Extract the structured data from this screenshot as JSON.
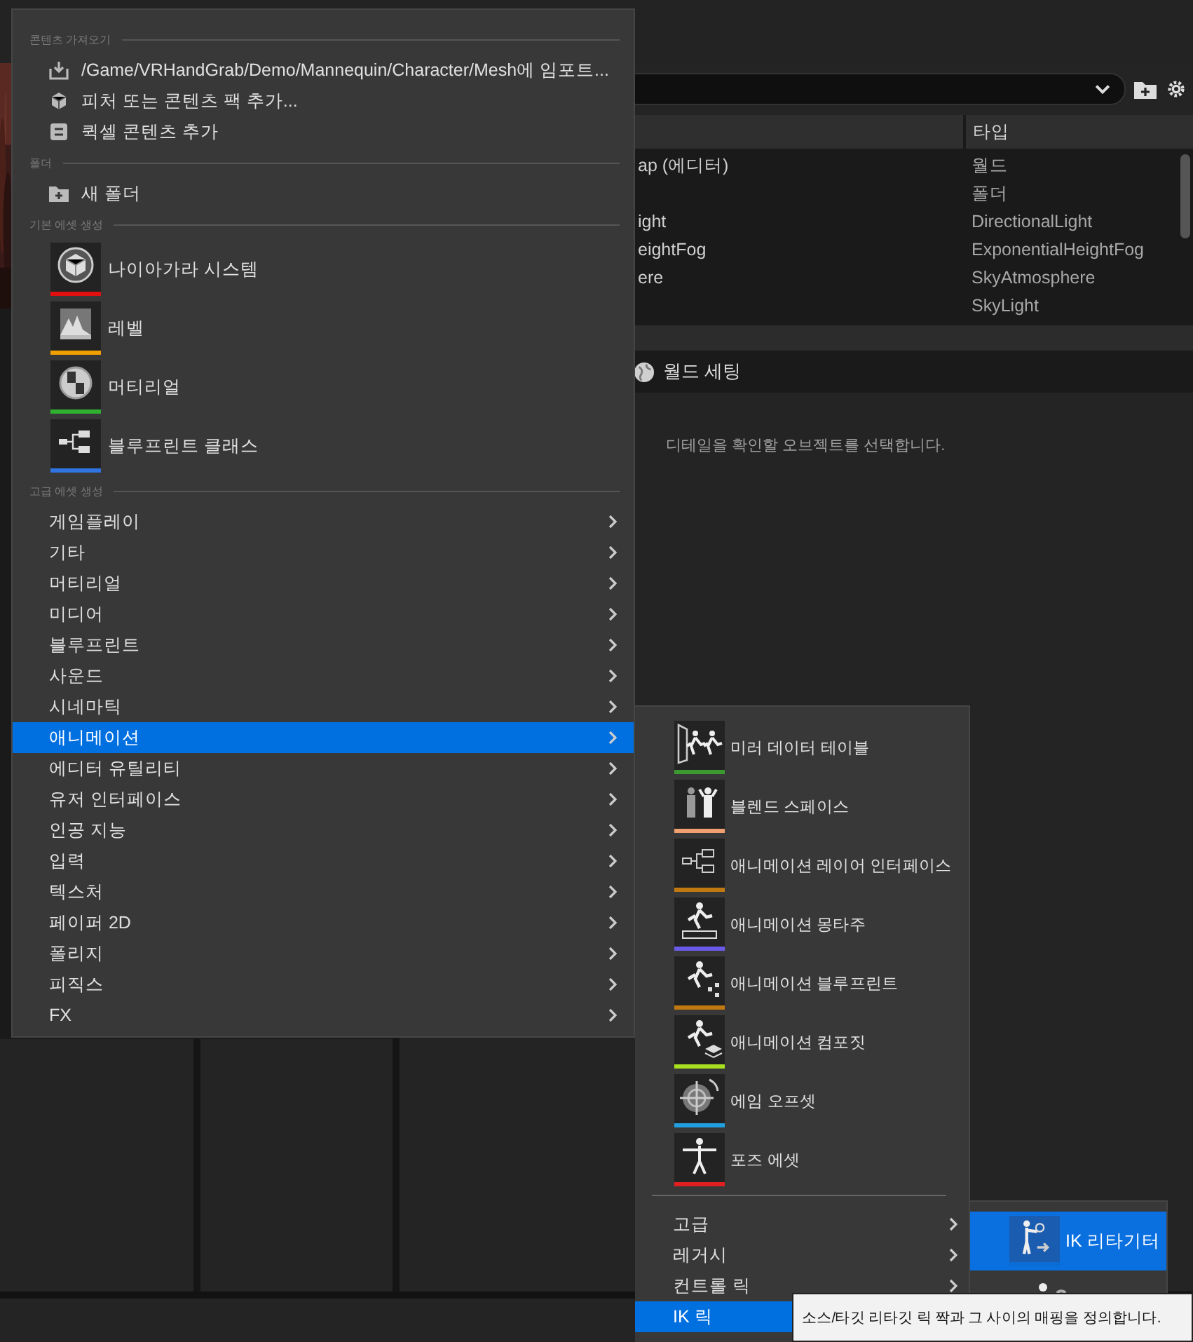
{
  "outliner": {
    "type_header": "타입",
    "rows": [
      {
        "name": "ap (에디터)",
        "type": "월드"
      },
      {
        "type": "폴더"
      },
      {
        "name": "ight",
        "type": "DirectionalLight"
      },
      {
        "name": "eightFog",
        "type": "ExponentialHeightFog"
      },
      {
        "name": "ere",
        "type": "SkyAtmosphere"
      },
      {
        "type": "SkyLight"
      }
    ]
  },
  "details": {
    "tab": "월드 세팅",
    "message": "디테일을 확인할 오브젝트를 선택합니다."
  },
  "menu": {
    "sections": [
      {
        "heading": "콘텐츠 가져오기",
        "items": [
          {
            "kind": "action",
            "label": "/Game/VRHandGrab/Demo/Mannequin/Character/Mesh에 임포트..."
          },
          {
            "kind": "action",
            "label": "피처 또는 콘텐츠 팩 추가..."
          },
          {
            "kind": "action",
            "label": "퀵셀 콘텐츠 추가"
          }
        ]
      },
      {
        "heading": "폴더",
        "items": [
          {
            "kind": "action",
            "label": "새 폴더"
          }
        ]
      },
      {
        "heading": "기본 에셋 생성",
        "items": [
          {
            "kind": "asset",
            "label": "나이아가라 시스템",
            "color": "#e01010"
          },
          {
            "kind": "asset",
            "label": "레벨",
            "color": "#f0a000"
          },
          {
            "kind": "asset",
            "label": "머티리얼",
            "color": "#30b030"
          },
          {
            "kind": "asset",
            "label": "블루프린트 클래스",
            "color": "#2f74e0"
          }
        ]
      },
      {
        "heading": "고급 에셋 생성",
        "items": [
          {
            "kind": "category",
            "label": "게임플레이",
            "selected": false
          },
          {
            "kind": "category",
            "label": "기타",
            "selected": false
          },
          {
            "kind": "category",
            "label": "머티리얼",
            "selected": false
          },
          {
            "kind": "category",
            "label": "미디어",
            "selected": false
          },
          {
            "kind": "category",
            "label": "블루프린트",
            "selected": false
          },
          {
            "kind": "category",
            "label": "사운드",
            "selected": false
          },
          {
            "kind": "category",
            "label": "시네마틱",
            "selected": false
          },
          {
            "kind": "category",
            "label": "애니메이션",
            "selected": true
          },
          {
            "kind": "category",
            "label": "에디터 유틸리티",
            "selected": false
          },
          {
            "kind": "category",
            "label": "유저 인터페이스",
            "selected": false
          },
          {
            "kind": "category",
            "label": "인공 지능",
            "selected": false
          },
          {
            "kind": "category",
            "label": "입력",
            "selected": false
          },
          {
            "kind": "category",
            "label": "텍스처",
            "selected": false
          },
          {
            "kind": "category",
            "label": "페이퍼 2D",
            "selected": false
          },
          {
            "kind": "category",
            "label": "폴리지",
            "selected": false
          },
          {
            "kind": "category",
            "label": "피직스",
            "selected": false
          },
          {
            "kind": "category",
            "label": "FX",
            "selected": false
          }
        ]
      }
    ]
  },
  "submenu": {
    "assets": [
      {
        "label": "미러 데이터 테이블",
        "color": "#3a9a30"
      },
      {
        "label": "블렌드 스페이스",
        "color": "#f0a070"
      },
      {
        "label": "애니메이션 레이어 인터페이스",
        "color": "#c07810"
      },
      {
        "label": "애니메이션 몽타주",
        "color": "#6a5ae8"
      },
      {
        "label": "애니메이션 블루프린트",
        "color": "#c07810"
      },
      {
        "label": "애니메이션 컴포짓",
        "color": "#a8e020"
      },
      {
        "label": "에임 오프셋",
        "color": "#20a0e0"
      },
      {
        "label": "포즈 에셋",
        "color": "#e02020"
      }
    ],
    "groups": [
      {
        "label": "고급",
        "selected": false
      },
      {
        "label": "레거시",
        "selected": false
      },
      {
        "label": "컨트롤 릭",
        "selected": false
      },
      {
        "label": "IK 릭",
        "selected": true
      }
    ]
  },
  "subsubmenu": {
    "items": [
      {
        "label": "IK 리타기터",
        "selected": true,
        "color": "#0a6cd4"
      }
    ]
  },
  "tooltip": "소스/타깃 리타깃 릭 짝과 그 사이의 매핑을 정의합니다."
}
